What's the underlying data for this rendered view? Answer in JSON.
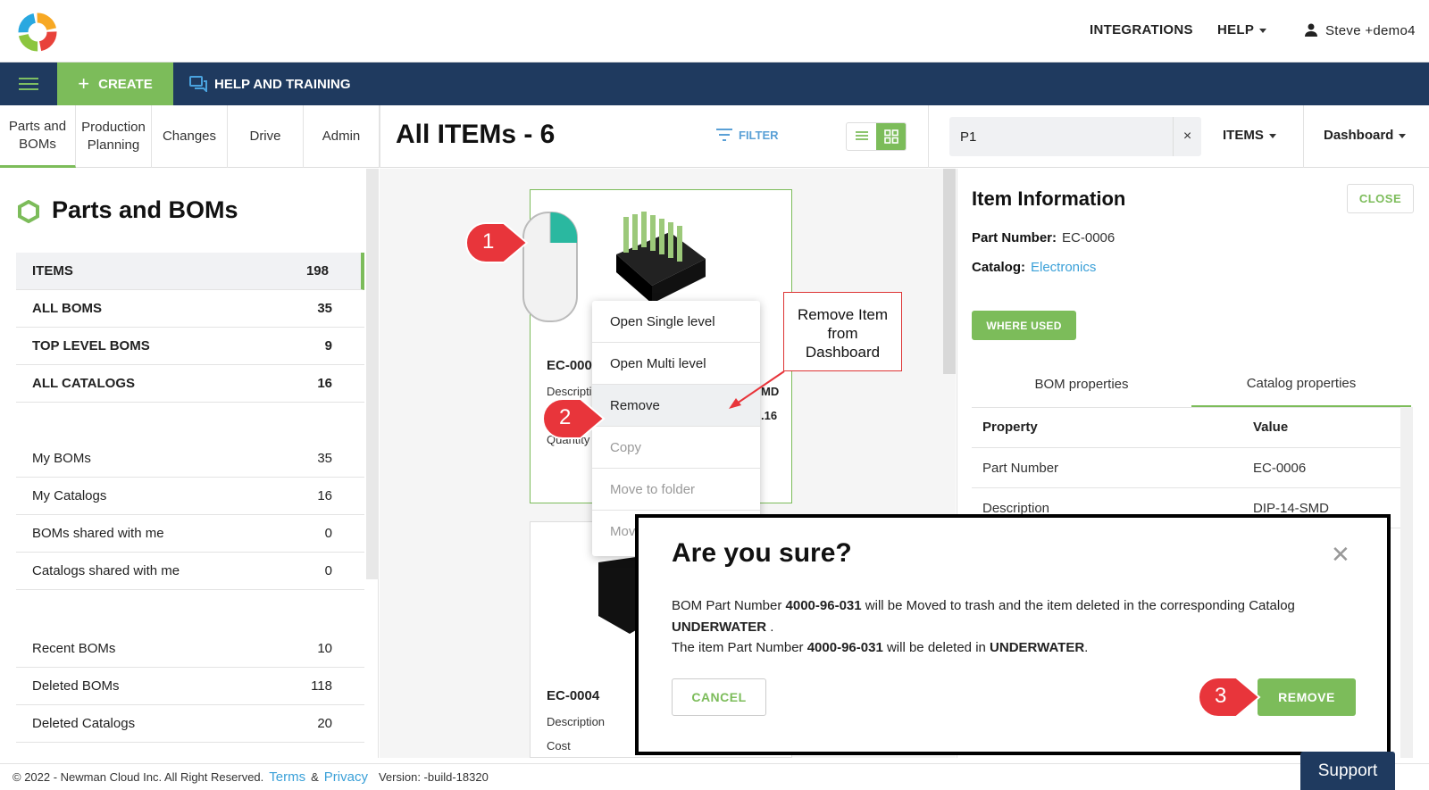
{
  "header": {
    "integrations": "INTEGRATIONS",
    "help": "HELP",
    "user": "Steve +demo4"
  },
  "navbar": {
    "create": "CREATE",
    "help_training": "HELP AND TRAINING"
  },
  "tabs": [
    {
      "label_line1": "Parts and",
      "label_line2": "BOMs"
    },
    {
      "label_line1": "Production",
      "label_line2": "Planning"
    },
    {
      "label_line1": "Changes",
      "label_line2": ""
    },
    {
      "label_line1": "Drive",
      "label_line2": ""
    },
    {
      "label_line1": "Admin",
      "label_line2": ""
    }
  ],
  "main": {
    "title": "All ITEMs - 6",
    "filter": "FILTER"
  },
  "search": {
    "value": "P1",
    "clear": "×",
    "items_dropdown": "ITEMS",
    "dashboard_dropdown": "Dashboard"
  },
  "sidebar": {
    "title": "Parts and BOMs",
    "group1": [
      {
        "label": "ITEMS",
        "count": "198"
      },
      {
        "label": "ALL BOMS",
        "count": "35"
      },
      {
        "label": "TOP LEVEL BOMS",
        "count": "9"
      },
      {
        "label": "ALL CATALOGS",
        "count": "16"
      }
    ],
    "group2": [
      {
        "label": "My BOMs",
        "count": "35"
      },
      {
        "label": "My Catalogs",
        "count": "16"
      },
      {
        "label": "BOMs shared with me",
        "count": "0"
      },
      {
        "label": "Catalogs shared with me",
        "count": "0"
      }
    ],
    "group3": [
      {
        "label": "Recent BOMs",
        "count": "10"
      },
      {
        "label": "Deleted BOMs",
        "count": "118"
      },
      {
        "label": "Deleted Catalogs",
        "count": "20"
      }
    ]
  },
  "cards": {
    "card1": {
      "part": "EC-000",
      "desc_label": "Descripti",
      "desc_val_partial": "MD",
      "cost_val_partial": ".16",
      "qty_label": "Quantity"
    },
    "card2": {
      "part": "EC-0004",
      "desc_label": "Description",
      "cost_label": "Cost"
    }
  },
  "context_menu": {
    "items": [
      "Open Single level",
      "Open Multi level",
      "Remove",
      "Copy",
      "Move to folder",
      "Mov"
    ]
  },
  "info_panel": {
    "title": "Item Information",
    "close": "CLOSE",
    "part_number_label": "Part Number:",
    "part_number_value": "EC-0006",
    "catalog_label": "Catalog:",
    "catalog_value": "Electronics",
    "where_used": "WHERE USED",
    "tab_bom": "BOM properties",
    "tab_catalog": "Catalog properties",
    "col_property": "Property",
    "col_value": "Value",
    "rows": [
      {
        "property": "Part Number",
        "value": "EC-0006"
      },
      {
        "property": "Description",
        "value": "DIP-14-SMD"
      }
    ]
  },
  "modal": {
    "title": "Are you sure?",
    "line1_a": "BOM Part Number ",
    "line1_b": "4000-96-031",
    "line1_c": " will be Moved to trash and the item deleted in the corresponding Catalog",
    "line2_a": "UNDERWATER",
    "line2_b": " .",
    "line3_a": "The item Part Number ",
    "line3_b": "4000-96-031",
    "line3_c": " will be deleted in ",
    "line3_d": "UNDERWATER",
    "line3_e": ".",
    "cancel": "CANCEL",
    "remove": "REMOVE"
  },
  "callouts": {
    "step1": "1",
    "step2": "2",
    "step3": "3",
    "note_line1": "Remove Item",
    "note_line2": "from",
    "note_line3": "Dashboard"
  },
  "footer": {
    "copyright": "© 2022 - Newman Cloud Inc. All Right Reserved.",
    "terms": "Terms",
    "amp": "&",
    "privacy": "Privacy",
    "version": "Version: -build-18320",
    "support": "Support"
  },
  "colors": {
    "accent_green": "#7cbc5a",
    "navbar_blue": "#1f3a5f",
    "link_blue": "#3aa0d8",
    "callout_red": "#e8353b"
  }
}
